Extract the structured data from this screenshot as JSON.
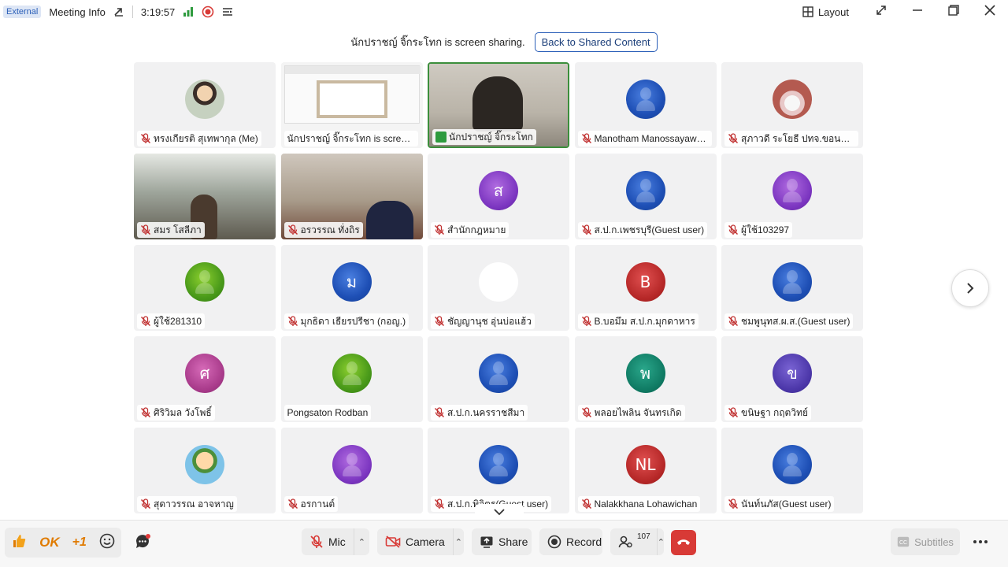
{
  "titlebar": {
    "external_badge": "External",
    "meeting_info": "Meeting Info",
    "duration": "3:19:57",
    "layout_label": "Layout"
  },
  "banner": {
    "sharing_text": "นักปราชญ์ จิ๊กระโทก is screen sharing.",
    "back_button": "Back to Shared Content"
  },
  "participants": [
    {
      "name": "ทรงเกียรติ สุเทพากุล (Me)",
      "avatar": "photo",
      "initial": "",
      "muted": true
    },
    {
      "name": "นักปราชญ์ จิ๊กระโทก is screen sharing",
      "avatar": "screen",
      "initial": "",
      "muted": false
    },
    {
      "name": "นักปราชญ์ จิ๊กระโทก",
      "avatar": "video",
      "initial": "",
      "muted": false,
      "sharing": true
    },
    {
      "name": "Manotham Manossayawong",
      "avatar": "blue-person",
      "initial": "",
      "muted": true
    },
    {
      "name": "สุภาวดี ระโยธี ปทจ.ขอนแก่น",
      "avatar": "photo2",
      "initial": "",
      "muted": true
    },
    {
      "name": "สมร โสลีภา",
      "avatar": "video",
      "initial": "",
      "muted": true
    },
    {
      "name": "อรวรรณ ทั่งถิร",
      "avatar": "video",
      "initial": "",
      "muted": true
    },
    {
      "name": "สำนักกฎหมาย",
      "avatar": "purple",
      "initial": "ส",
      "muted": true
    },
    {
      "name": "ส.ป.ก.เพชรบุรี(Guest user)",
      "avatar": "blue-person",
      "initial": "",
      "muted": true
    },
    {
      "name": "ผู้ใช้103297",
      "avatar": "purple-person",
      "initial": "",
      "muted": true
    },
    {
      "name": "ผู้ใช้281310",
      "avatar": "green-person",
      "initial": "",
      "muted": true
    },
    {
      "name": "มุกธิดา เธียรปรีชา (กอญ.)",
      "avatar": "blue",
      "initial": "ม",
      "muted": true
    },
    {
      "name": "ชัญญานุช อุ่นบ่อแฮ้ว",
      "avatar": "white",
      "initial": "",
      "muted": true
    },
    {
      "name": "B.บอมึม ส.ป.ก.มุกดาหาร",
      "avatar": "red",
      "initial": "B",
      "muted": true
    },
    {
      "name": "ชมพูนุทส.ผ.ส.(Guest user)",
      "avatar": "blue-person",
      "initial": "",
      "muted": true
    },
    {
      "name": "ศิริวิมล วังโพธิ์",
      "avatar": "magenta",
      "initial": "ศ",
      "muted": true
    },
    {
      "name": "Pongsaton Rodban",
      "avatar": "green-person",
      "initial": "",
      "muted": false
    },
    {
      "name": "ส.ป.ก.นครราชสีมา",
      "avatar": "blue-person",
      "initial": "",
      "muted": true
    },
    {
      "name": "พลอยไพลิน จันทรเกิด",
      "avatar": "teal",
      "initial": "พ",
      "muted": true
    },
    {
      "name": "ขนิษฐา กฤตวิทย์",
      "avatar": "indigo",
      "initial": "ข",
      "muted": true
    },
    {
      "name": "สุดาวรรณ อาจหาญ",
      "avatar": "cartoon",
      "initial": "",
      "muted": true
    },
    {
      "name": "อรกานต์",
      "avatar": "purple-person",
      "initial": "",
      "muted": true
    },
    {
      "name": "ส.ป.ก.พิจิตร(Guest user)",
      "avatar": "blue-person",
      "initial": "",
      "muted": true
    },
    {
      "name": "Nalakkhana Lohawichan",
      "avatar": "red",
      "initial": "NL",
      "muted": true
    },
    {
      "name": "นันท์นภัส(Guest user)",
      "avatar": "blue-person",
      "initial": "",
      "muted": true
    }
  ],
  "reactions": {
    "ok": "OK",
    "plus_one": "+1"
  },
  "toolbar": {
    "mic": "Mic",
    "camera": "Camera",
    "share": "Share",
    "record": "Record",
    "participants_count": "107",
    "subtitles": "Subtitles"
  },
  "colors": {
    "accent": "#2b5fb8",
    "hangup": "#d83a36",
    "active_border": "#3b8e3b"
  }
}
